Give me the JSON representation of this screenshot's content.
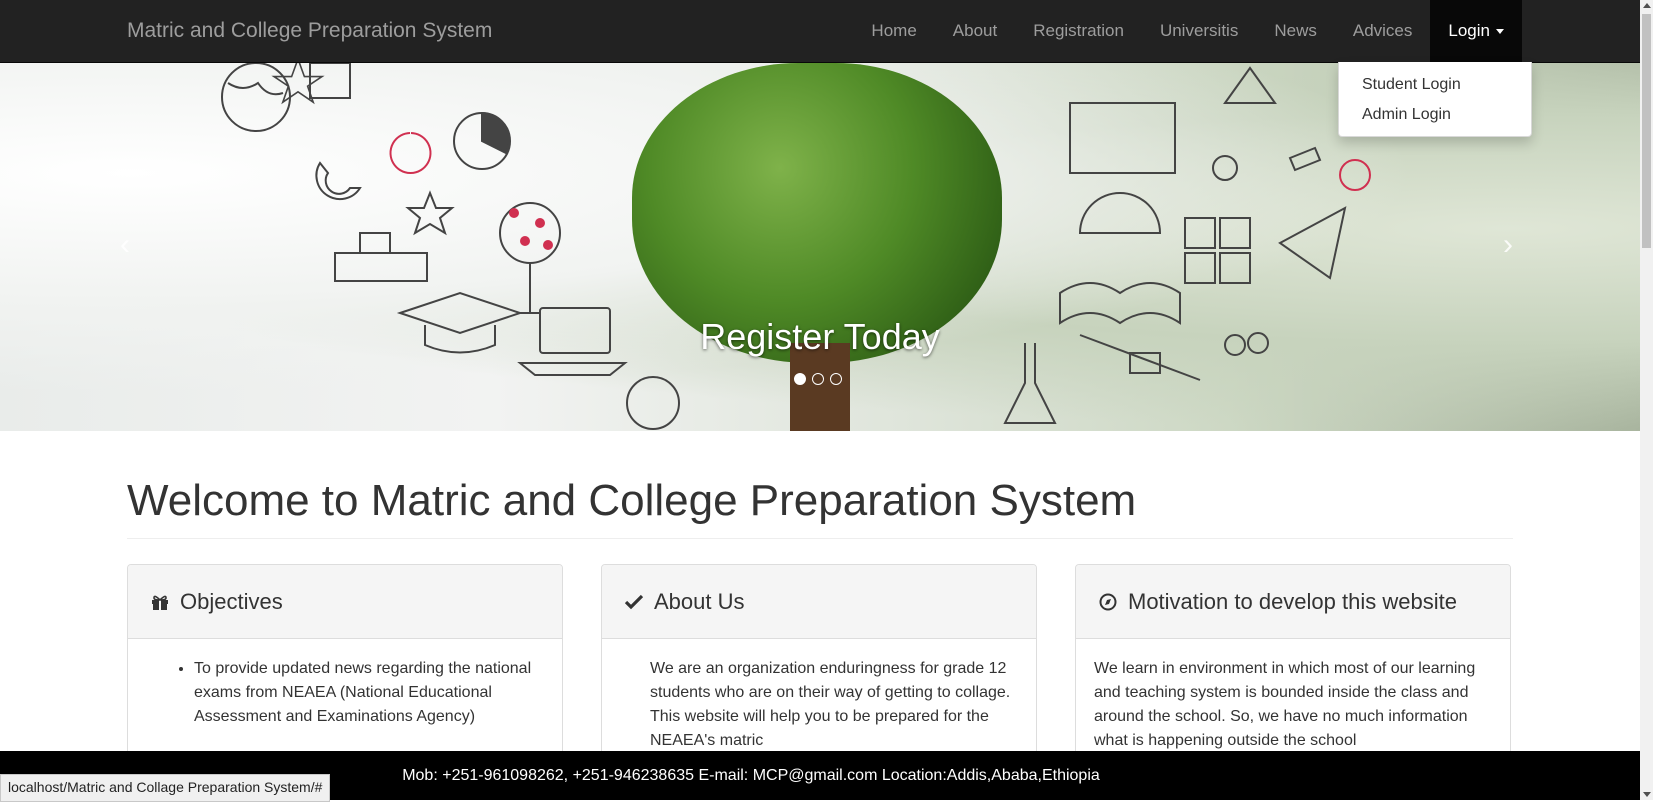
{
  "navbar": {
    "brand": "Matric and College Preparation System",
    "items": [
      {
        "label": "Home"
      },
      {
        "label": "About"
      },
      {
        "label": "Registration"
      },
      {
        "label": "Universitis"
      },
      {
        "label": "News"
      },
      {
        "label": "Advices"
      },
      {
        "label": "Login"
      }
    ],
    "login_dropdown": [
      "Student Login",
      "Admin Login"
    ]
  },
  "carousel": {
    "caption": "Register Today",
    "prev_glyph": "‹",
    "next_glyph": "›",
    "slide_count": 3,
    "active_slide": 1
  },
  "main": {
    "title": "Welcome to Matric and College Preparation System",
    "panels": [
      {
        "title": "Objectives",
        "icon": "gift-icon",
        "items": [
          "To provide updated news regarding the national exams from NEAEA (National Educational Assessment and Examinations Agency)"
        ]
      },
      {
        "title": "About Us",
        "icon": "check-icon",
        "text": "We are an organization enduringness for grade 12 students who are on their way of getting to collage. This website will help you to be prepared for the NEAEA's matric"
      },
      {
        "title": "Motivation to develop this website",
        "icon": "compass-icon",
        "text": "We learn in environment in which most of our learning and teaching system is bounded inside the class and around the school. So, we have no much information what is happening outside the school"
      }
    ]
  },
  "footer": {
    "text": "Mob: +251-961098262, +251-946238635 E-mail: MCP@gmail.com Location:Addis,Ababa,Ethiopia"
  },
  "statusbar": {
    "url": "localhost/Matric and Collage Preparation System/#"
  },
  "colors": {
    "navbar_bg": "#222222",
    "nav_active_bg": "#080808",
    "footer_bg": "#000000"
  }
}
